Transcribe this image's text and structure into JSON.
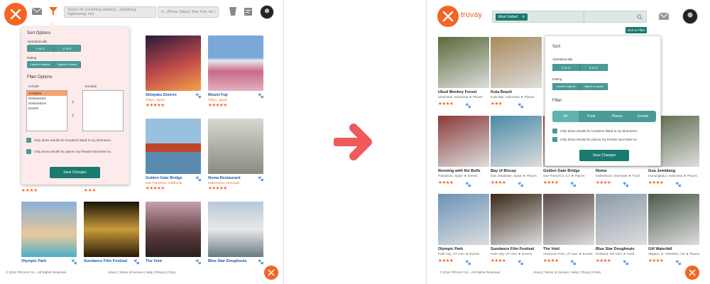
{
  "left": {
    "search_placeholder": "Search for something amazing... (Skydiving, Sightseeing, etc)",
    "location_placeholder": "in...(Roma, Napoli, New York, etc.)",
    "popup": {
      "sort_title": "Sort Options",
      "alpha_label": "Alphabetically",
      "alpha_buttons": [
        "A to Z",
        "Z to A"
      ],
      "rating_label": "Rating",
      "rating_buttons": [
        "Lowest to Highest",
        "Highest to Lowest"
      ],
      "filter_title": "Filter Options",
      "include_label": "Include",
      "exclude_label": "Exclude",
      "include_items": [
        "Activities",
        "Restaurants",
        "Destinations",
        "Events"
      ],
      "check1": "Only show results for locations listed in my itineraries.",
      "check2": "Only show results for places my friends have been to.",
      "save": "Save Changes"
    },
    "cards": [
      {
        "title": "Shinjuku District",
        "sub": "Tokyo, Japan",
        "stars": "★★★★★",
        "color": "#8a3a4a"
      },
      {
        "title": "Mount Fuji",
        "sub": "Tokyo, Japan",
        "stars": "★★★★★",
        "color": "#c79aa8"
      },
      {
        "title": "Golden Gate Bridge",
        "sub": "San Francisco, California",
        "stars": "★★★★★",
        "color": "#b8462a"
      },
      {
        "title": "Noma Restaurant",
        "sub": "København, Denmark",
        "stars": "★★★★★",
        "color": "#a8a8a0"
      },
      {
        "title": "Olympic Park",
        "sub": "",
        "stars": "",
        "color": "#6a93b8"
      },
      {
        "title": "Sundance Film Festival",
        "sub": "",
        "stars": "",
        "color": "#3a2a1a"
      },
      {
        "title": "The Void",
        "sub": "",
        "stars": "",
        "color": "#5a4a4a"
      },
      {
        "title": "Blue Star Doughnuts",
        "sub": "",
        "stars": "",
        "color": "#8a9aa8"
      }
    ],
    "row2_stars": [
      "★★★★",
      "★★★"
    ],
    "footer_copy": "© 2016 TRUVAY Inc., All Rights Reserved",
    "footer_links": "About  |  Terms of Service  |  Help  |  Privacy Policy"
  },
  "right": {
    "brand": "truvay",
    "search_tag": "Most Visited",
    "tooltip": "Sort & Filter",
    "popup": {
      "sort_title": "Sort",
      "alpha_label": "Alphabetically",
      "alpha_buttons": [
        "A to Z",
        "Z to A"
      ],
      "rating_label": "Rating",
      "rating_buttons": [
        "Lowest to Highest",
        "Highest to Lowest"
      ],
      "filter_title": "Filter",
      "segments": [
        "All",
        "Food",
        "Places",
        "Events"
      ],
      "check1": "Only show results for locations listed in my itineraries.",
      "check2": "Only show results for places my friends have been to.",
      "save": "Save Changes"
    },
    "cards": [
      {
        "title": "Ubud Monkey Forest",
        "sub": "Ubud Bali, Indonesia ★ Places",
        "stars": "★★★★",
        "color": "#5a6a3a"
      },
      {
        "title": "Kuta Beach",
        "sub": "Kuta Bali, Indonesia ★ Places",
        "stars": "★★★",
        "color": "#a88a5a"
      },
      {
        "title": "Running with the Bulls",
        "sub": "Pamplona, Spain ★ Events",
        "stars": "★★★★",
        "color": "#8a3a3a"
      },
      {
        "title": "Bay of Biscay",
        "sub": "San Sebastian, Spain ★ Places",
        "stars": "★★★★",
        "color": "#4a8aa8"
      },
      {
        "title": "Golden Gate Bridge",
        "sub": "San Francisco, CA ★ Places",
        "stars": "★★★★",
        "color": "#b8462a"
      },
      {
        "title": "Noma",
        "sub": "København, Denmark ★ Food",
        "stars": "★★★★",
        "color": "#a8a8a0"
      },
      {
        "title": "Gua Jomblang",
        "sub": "Gunungkidul, Indonesia ★ Places",
        "stars": "★★★★",
        "color": "#5a6a4a"
      },
      {
        "title": "Olympic Park",
        "sub": "Park City, UT USA ★ Events",
        "stars": "★★★★",
        "color": "#6a93b8"
      },
      {
        "title": "Sundance Film Festival",
        "sub": "Park City, UT USA ★ Events",
        "stars": "★★★★",
        "color": "#3a2a1a"
      },
      {
        "title": "The Void",
        "sub": "American Fork, UT USA ★ Events",
        "stars": "★★★★",
        "color": "#5a4a4a"
      },
      {
        "title": "Blue Star Doughnuts",
        "sub": "Portland, OR USA ★ Food",
        "stars": "★★★★",
        "color": "#8a9aa8"
      },
      {
        "title": "Gill Waterfall",
        "sub": "Skipton, N. Yorkshire, UK ★ Places",
        "stars": "★★★★",
        "color": "#4a5a4a"
      }
    ],
    "footer_copy": "© 2016 TRUVAY Inc., All Rights Reserved",
    "footer_links": "About  |  Terms of Service  |  Help  |  Privacy Policy"
  },
  "colors": {
    "brand": "#f26522",
    "teal": "#4a9a96",
    "dark_teal": "#1a7a6f",
    "arrow": "#ef5a5a"
  }
}
